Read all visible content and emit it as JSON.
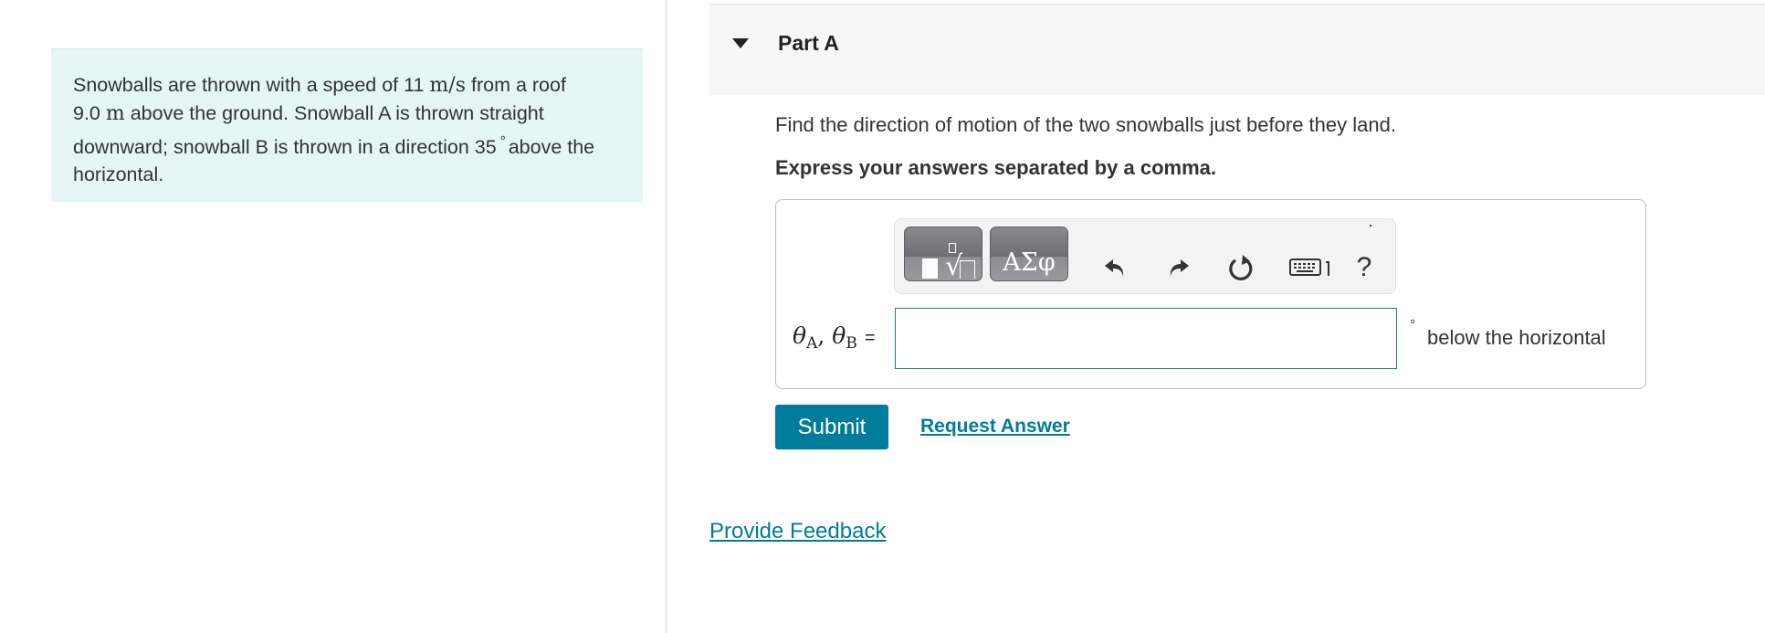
{
  "problem": {
    "text_part1": "Snowballs are thrown with a speed of 11 ",
    "speed_unit": "m/s",
    "text_part2": " from a roof ",
    "height_value": "9.0 ",
    "height_unit": "m",
    "text_part3": " above the ground. Snowball A is thrown straight downward; snowball B is thrown in a direction 35",
    "degree_symbol": "°",
    "text_part4": "above the horizontal."
  },
  "part": {
    "title": "Part A",
    "prompt": "Find the direction of motion of the two snowballs just before they land.",
    "instruction": "Express your answers separated by a comma."
  },
  "toolbar": {
    "templates_icon": "templates-icon",
    "symbols_label": "ΑΣφ",
    "undo_icon": "undo-icon",
    "redo_icon": "redo-icon",
    "reset_icon": "reset-icon",
    "keyboard_icon": "keyboard-icon",
    "help_label": "?"
  },
  "answer": {
    "theta": "θ",
    "sub_a": "A",
    "sub_b": "B",
    "separator": ", ",
    "equals": "=",
    "input_value": "",
    "unit_degree": "°",
    "unit_text": "below the horizontal"
  },
  "actions": {
    "submit_label": "Submit",
    "request_answer_label": "Request Answer",
    "feedback_label": "Provide Feedback"
  },
  "colors": {
    "accent": "#007c9b",
    "problem_bg": "#e6f5f6",
    "header_bg": "#f7f7f7"
  }
}
